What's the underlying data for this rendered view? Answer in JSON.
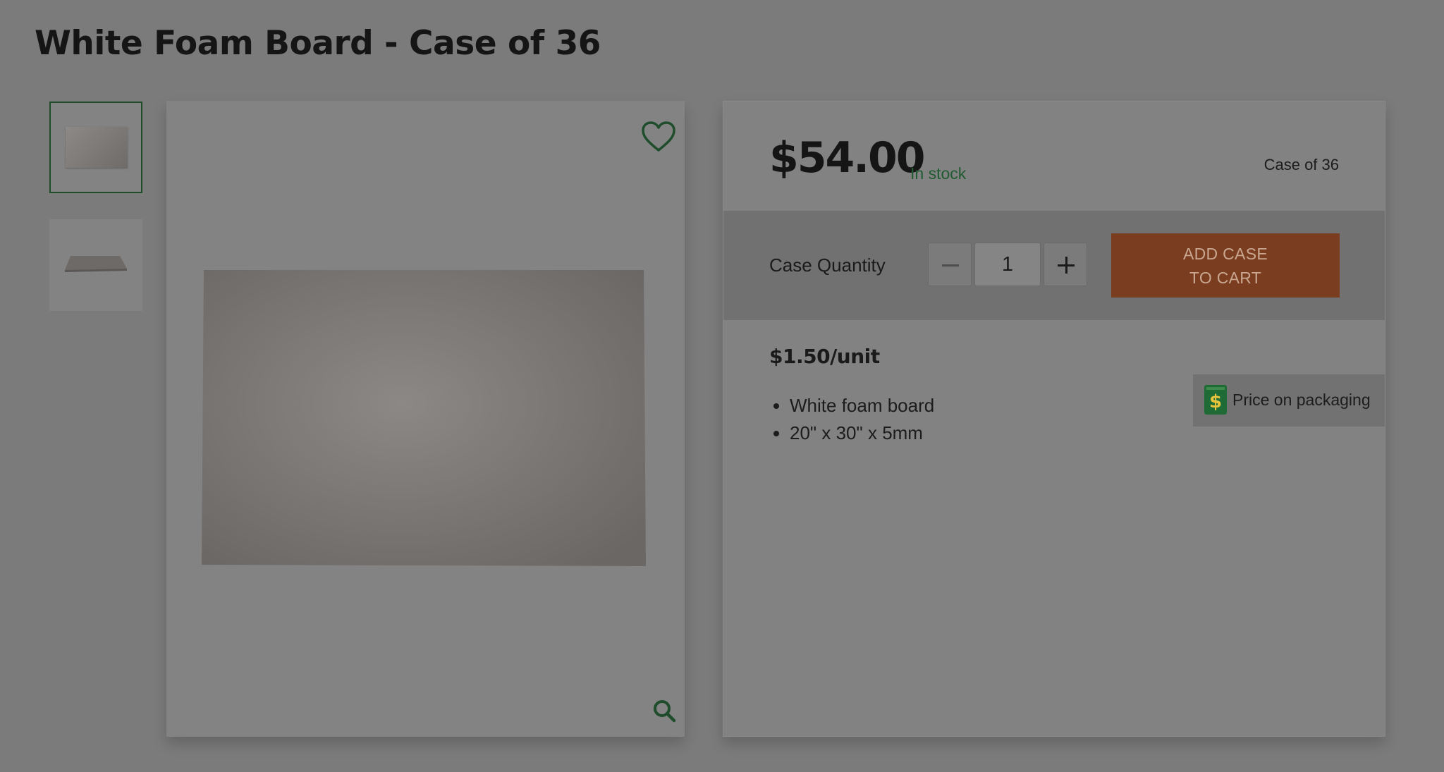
{
  "product": {
    "title": "White Foam Board - Case of 36"
  },
  "gallery": {
    "thumbnails": [
      {
        "label": "",
        "icon": "foam-board-front"
      },
      {
        "label": "",
        "icon": "foam-board-angle"
      }
    ],
    "active_index": 0,
    "wishlist_icon": "heart-icon",
    "zoom_icon": "search-icon"
  },
  "purchase": {
    "price": "$54.00",
    "stock_status": "In stock",
    "case_size": "Case of 36",
    "quantity_label": "Case Quantity",
    "quantity_value": "1",
    "add_button_line1": "ADD CASE",
    "add_button_line2": "TO CART",
    "unit_price": "$1.50/unit",
    "features": [
      "White foam board",
      "20\" x 30\" x 5mm"
    ],
    "packaging_badge": "Price on packaging",
    "packaging_icon_glyph": "$"
  },
  "colors": {
    "brand_green": "#1f5a30",
    "cta_orange": "#7a3d1f"
  }
}
